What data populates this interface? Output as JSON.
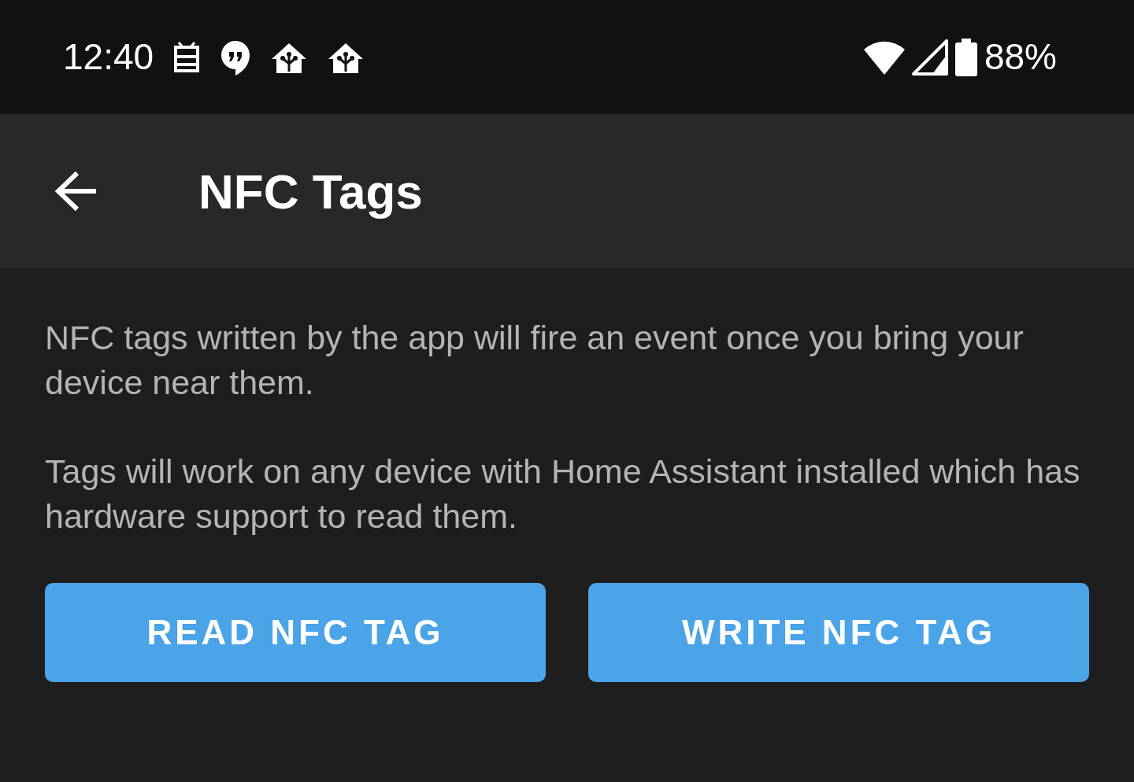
{
  "status_bar": {
    "time": "12:40",
    "battery": "88%"
  },
  "toolbar": {
    "title": "NFC Tags"
  },
  "paragraphs": [
    "NFC tags written by the app will fire an event once you bring your device near them.",
    "Tags will work on any device with Home Assistant installed which has hardware support to read them."
  ],
  "buttons": [
    {
      "label": "READ NFC TAG"
    },
    {
      "label": "WRITE NFC TAG"
    }
  ]
}
